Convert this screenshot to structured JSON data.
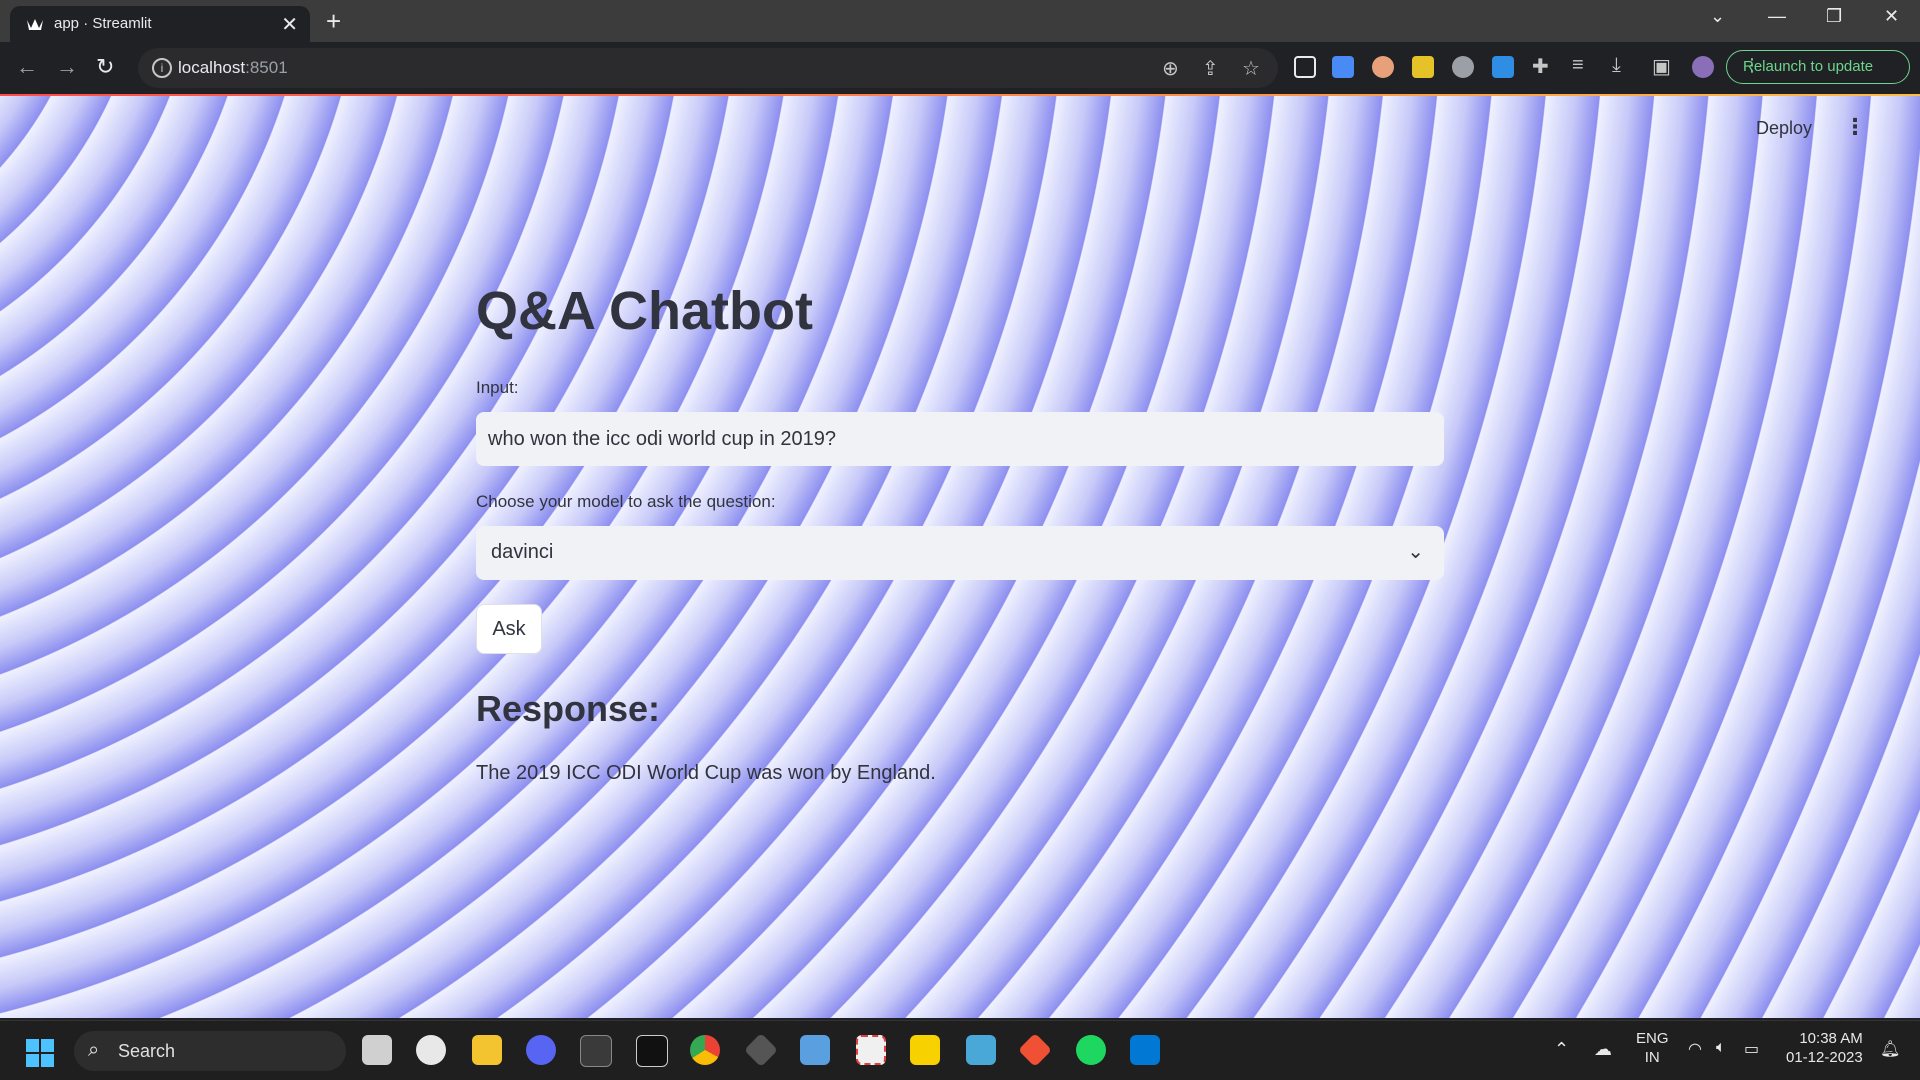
{
  "browser": {
    "tab_title": "app · Streamlit",
    "tab_close": "✕",
    "new_tab": "+",
    "url_host": "localhost",
    "url_port": ":8501",
    "relaunch_label": "Relaunch to update"
  },
  "app": {
    "deploy_label": "Deploy",
    "menu_icon": "⋮",
    "title": "Q&A Chatbot",
    "input_label": "Input:",
    "input_value": "who won the icc odi world cup in 2019?",
    "model_label": "Choose your model to ask the question:",
    "model_selected": "davinci",
    "ask_label": "Ask",
    "response_heading": "Response:",
    "response_text": "The 2019 ICC ODI World Cup was won by England."
  },
  "taskbar": {
    "search_label": "Search",
    "lang_top": "ENG",
    "lang_bottom": "IN",
    "time": "10:38 AM",
    "date": "01-12-2023"
  },
  "colors": {
    "streamlit_text": "#31333f",
    "input_bg": "#f0f2f6",
    "relaunch_green": "#6dd58c",
    "accent_blue": "#4cc2ff"
  }
}
